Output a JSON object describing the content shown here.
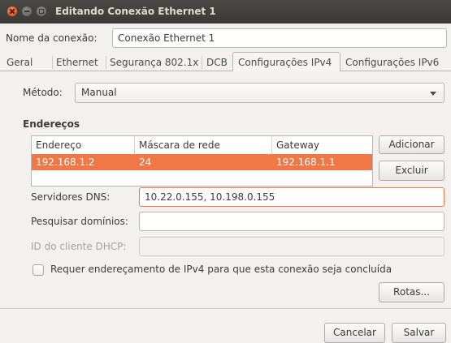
{
  "window": {
    "title": "Editando Conexão Ethernet 1"
  },
  "connection_name": {
    "label": "Nome da conexão:",
    "value": "Conexão Ethernet 1"
  },
  "tabs": [
    {
      "label": "Geral"
    },
    {
      "label": "Ethernet"
    },
    {
      "label": "Segurança 802.1x"
    },
    {
      "label": "DCB"
    },
    {
      "label": "Configurações IPv4"
    },
    {
      "label": "Configurações IPv6"
    }
  ],
  "method": {
    "label": "Método:",
    "value": "Manual"
  },
  "addresses": {
    "heading": "Endereços",
    "columns": [
      "Endereço",
      "Máscara de rede",
      "Gateway"
    ],
    "rows": [
      {
        "address": "192.168.1.2",
        "netmask": "24",
        "gateway": "192.168.1.1"
      }
    ],
    "add_label": "Adicionar",
    "remove_label": "Excluir"
  },
  "dns": {
    "label": "Servidores DNS:",
    "value": "10.22.0.155, 10.198.0.155"
  },
  "search_domains": {
    "label": "Pesquisar domínios:",
    "value": ""
  },
  "dhcp_client_id": {
    "label": "ID do cliente DHCP:",
    "value": ""
  },
  "require_ipv4": {
    "label": "Requer endereçamento de IPv4 para que esta conexão seja concluída",
    "checked": false
  },
  "routes_label": "Rotas...",
  "footer": {
    "cancel_label": "Cancelar",
    "save_label": "Salvar"
  }
}
